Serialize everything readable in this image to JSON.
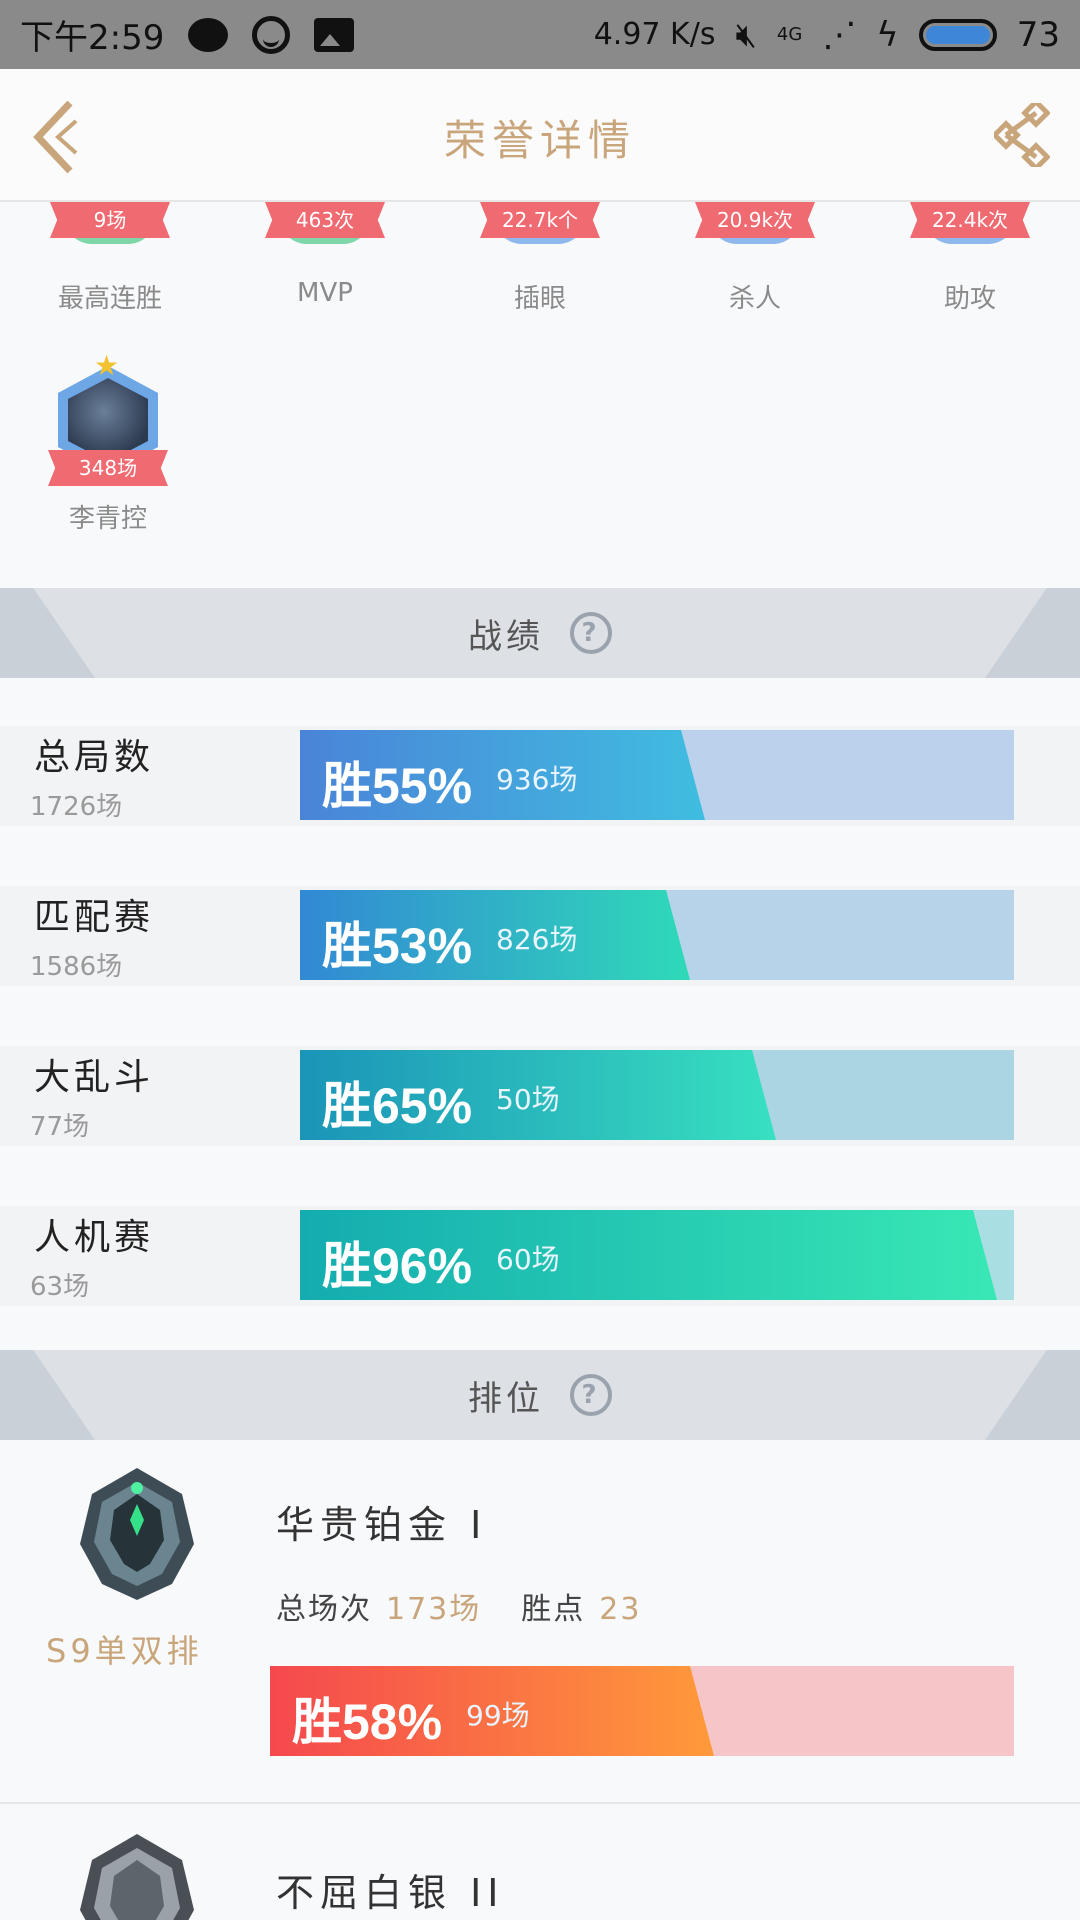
{
  "status_bar": {
    "time": "下午2:59",
    "net_speed": "4.97 K/s",
    "network": "4G",
    "battery": "73"
  },
  "nav": {
    "title": "荣誉详情"
  },
  "honors": [
    {
      "label": "最高连胜",
      "value": "9场",
      "color": "#7fd6a8"
    },
    {
      "label": "MVP",
      "value": "463次",
      "color": "#7fd6a8"
    },
    {
      "label": "插眼",
      "value": "22.7k个",
      "color": "#8fb8ec"
    },
    {
      "label": "杀人",
      "value": "20.9k次",
      "color": "#8fb8ec"
    },
    {
      "label": "助攻",
      "value": "22.4k次",
      "color": "#8fb8ec"
    }
  ],
  "hero_honor": {
    "label": "李青控",
    "value": "348场"
  },
  "stats_section": {
    "title": "战绩"
  },
  "stats": [
    {
      "name": "总局数",
      "total": "1726场",
      "win_pct": "胜55%",
      "wins": "936场",
      "fill": 0.55,
      "from": "#4a84d8",
      "to": "#40bde0",
      "track": "#bcd1ec"
    },
    {
      "name": "匹配赛",
      "total": "1586场",
      "win_pct": "胜53%",
      "wins": "826场",
      "fill": 0.53,
      "from": "#3288d4",
      "to": "#2fdab8",
      "track": "#b6d3ea"
    },
    {
      "name": "大乱斗",
      "total": "77场",
      "win_pct": "胜65%",
      "wins": "50场",
      "fill": 0.65,
      "from": "#1b94b8",
      "to": "#38e0c0",
      "track": "#abd5e2"
    },
    {
      "name": "人机赛",
      "total": "63场",
      "win_pct": "胜96%",
      "wins": "60场",
      "fill": 0.96,
      "from": "#14acb0",
      "to": "#38e8b4",
      "track": "#a9dfe2"
    }
  ],
  "rank_section": {
    "title": "排位"
  },
  "ranks": [
    {
      "queue": "S9单双排",
      "tier": "华贵铂金 I",
      "games_label": "总场次",
      "games": "173场",
      "points_label": "胜点",
      "points": "23",
      "win_pct": "胜58%",
      "wins": "99场",
      "fill": 0.58,
      "from": "#f5484e",
      "to": "#ff9a3a",
      "track": "#f6c5c8"
    },
    {
      "queue": "",
      "tier": "不屈白银 II"
    }
  ]
}
